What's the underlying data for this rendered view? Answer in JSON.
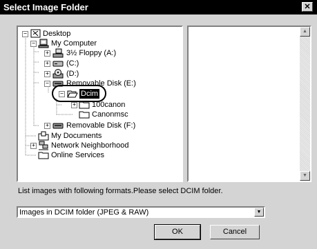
{
  "window": {
    "title": "Select Image Folder",
    "close_glyph": "✕"
  },
  "tree": {
    "items": [
      {
        "label": "Desktop",
        "icon": "desktop-icon",
        "expander": "−"
      },
      {
        "label": "My Computer",
        "icon": "computer-icon",
        "expander": "−"
      },
      {
        "label": "3½ Floppy (A:)",
        "icon": "floppy-drive-icon",
        "expander": "+"
      },
      {
        "label": "(C:)",
        "icon": "hard-drive-icon",
        "expander": "+"
      },
      {
        "label": "(D:)",
        "icon": "cd-drive-icon",
        "expander": "+"
      },
      {
        "label": "Removable Disk (E:)",
        "icon": "removable-disk-icon",
        "expander": "−"
      },
      {
        "label": "Dcim",
        "icon": "open-folder-icon",
        "expander": "−",
        "selected": true
      },
      {
        "label": "100canon",
        "icon": "folder-icon",
        "expander": "+"
      },
      {
        "label": "Canonmsc",
        "icon": "folder-icon",
        "expander": ""
      },
      {
        "label": "Removable Disk (F:)",
        "icon": "removable-disk-icon",
        "expander": "+"
      },
      {
        "label": "My Documents",
        "icon": "documents-folder-icon",
        "expander": ""
      },
      {
        "label": "Network Neighborhood",
        "icon": "network-icon",
        "expander": "+"
      },
      {
        "label": "Online Services",
        "icon": "folder-icon",
        "expander": ""
      }
    ]
  },
  "message": "List images with following formats.Please select DCIM folder.",
  "format_select": {
    "value": "Images in DCIM folder (JPEG & RAW)",
    "arrow": "▼"
  },
  "buttons": {
    "ok": "OK",
    "cancel": "Cancel"
  },
  "scroll_arrows": {
    "up": "▲",
    "down": "▼"
  }
}
